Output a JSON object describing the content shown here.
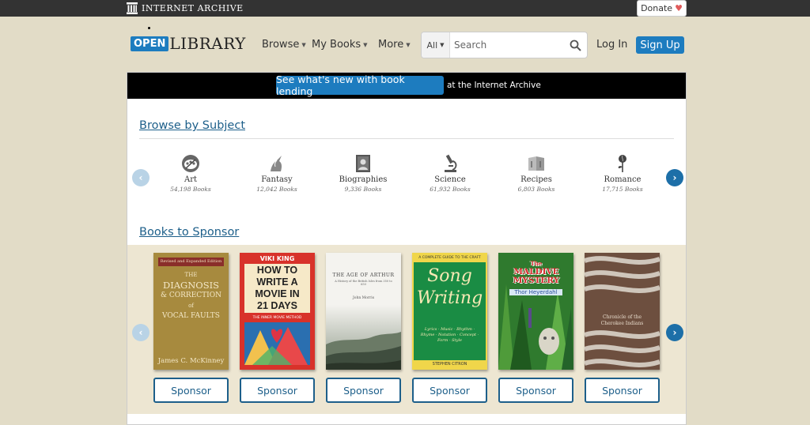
{
  "ia_bar": {
    "title": "INTERNET ARCHIVE",
    "donate_label": "Donate",
    "heart": "♥"
  },
  "header": {
    "logo_open": "OPEN",
    "logo_library": "LIBRARY",
    "nav": [
      {
        "label": "Browse"
      },
      {
        "label": "My Books"
      },
      {
        "label": "More"
      }
    ],
    "search": {
      "scope": "All",
      "placeholder": "Search",
      "icon": "search-icon"
    },
    "login_label": "Log In",
    "signup_label": "Sign Up"
  },
  "banner": {
    "button_label": "See what's new with book lending",
    "text": "at the Internet Archive"
  },
  "browse_subject": {
    "title": "Browse by Subject",
    "subjects": [
      {
        "name": "Art",
        "count": "54,198 Books",
        "icon": "palette-icon"
      },
      {
        "name": "Fantasy",
        "count": "12,042 Books",
        "icon": "unicorn-icon"
      },
      {
        "name": "Biographies",
        "count": "9,336 Books",
        "icon": "portrait-icon"
      },
      {
        "name": "Science",
        "count": "61,932 Books",
        "icon": "microscope-icon"
      },
      {
        "name": "Recipes",
        "count": "6,803 Books",
        "icon": "cookbook-icon"
      },
      {
        "name": "Romance",
        "count": "17,715 Books",
        "icon": "rose-icon"
      }
    ]
  },
  "books_to_sponsor": {
    "title": "Books to Sponsor",
    "button_label": "Sponsor",
    "books": [
      {
        "cover_top": "Revised and Expanded Edition",
        "title_lines": [
          "THE",
          "DIAGNOSIS",
          "& CORRECTION",
          "of",
          "VOCAL FAULTS"
        ],
        "author": "James C. McKinney"
      },
      {
        "author": "VIKI KING",
        "title_lines": [
          "HOW TO",
          "WRITE A",
          "MOVIE IN",
          "21 DAYS"
        ],
        "subtitle": "THE INNER MOVIE METHOD"
      },
      {
        "title_lines": [
          "THE AGE OF ARTHUR"
        ],
        "subtitle": "A History of the British Isles from 350 to 650",
        "author": "John Morris"
      },
      {
        "cover_top": "A COMPLETE GUIDE TO THE CRAFT",
        "title_lines": [
          "Song",
          "Writing"
        ],
        "subtitle": "Lyrics · Music · Rhythm · Rhyme · Notation · Concept · Form · Style",
        "author": "STEPHEN CITRON"
      },
      {
        "title_lines": [
          "The",
          "MALDIVE",
          "MYSTERY"
        ],
        "author": "Thor Heyerdahl"
      },
      {
        "title_lines": [
          "Chronicle of the",
          "Cherokee Indians"
        ]
      }
    ]
  }
}
